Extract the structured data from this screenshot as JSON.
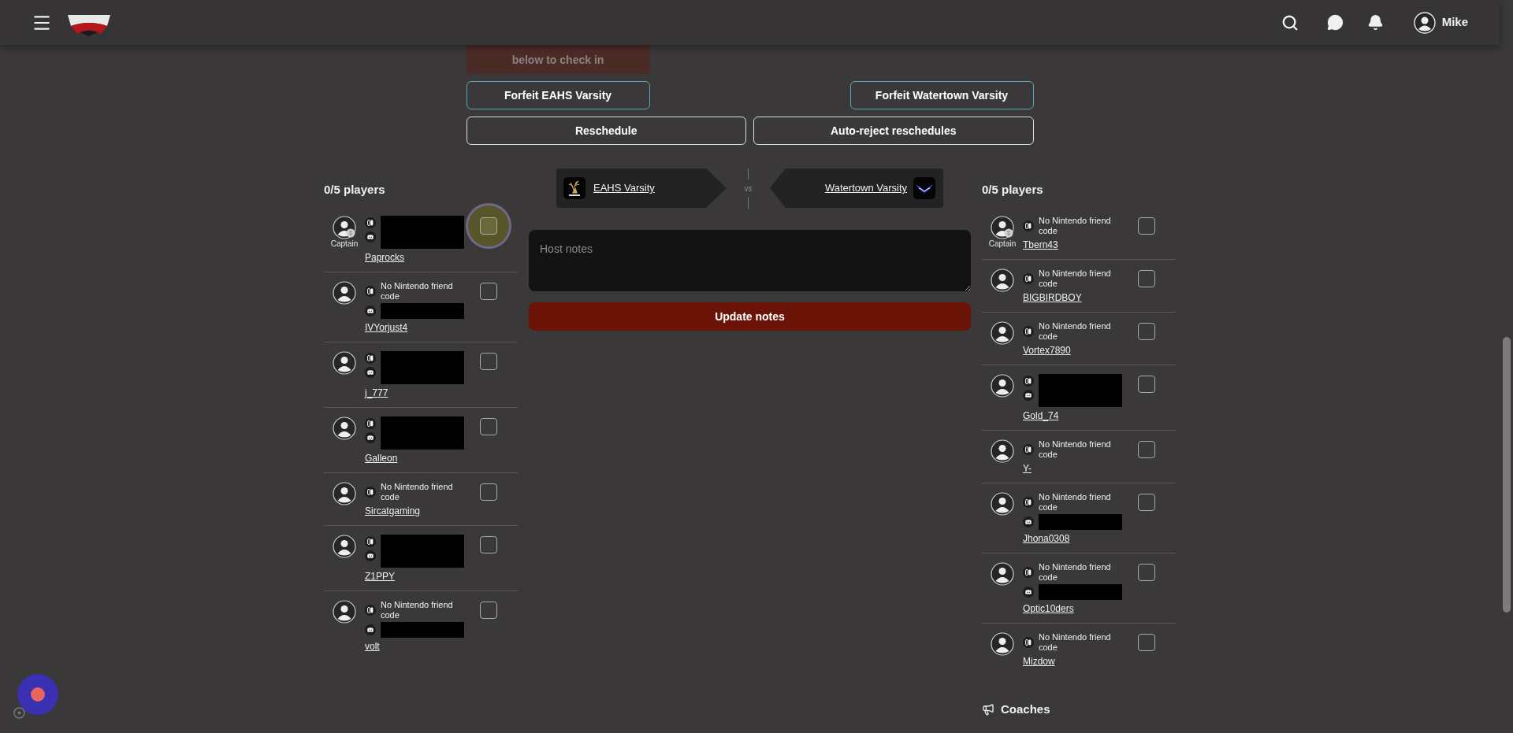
{
  "topbar": {
    "user": "Mike"
  },
  "checkin_notice": "below to check in",
  "actions": {
    "forfeit": [
      "Forfeit EAHS Varsity",
      "Forfeit Watertown Varsity"
    ],
    "reschedule": "Reschedule",
    "auto_reject": "Auto-reject reschedules"
  },
  "matchup": {
    "home": "EAHS Varsity",
    "away": "Watertown Varsity",
    "vs": "vs"
  },
  "notes": {
    "placeholder": "Host notes",
    "button": "Update notes"
  },
  "teams": [
    {
      "count": "0/5 players",
      "players": [
        {
          "name": "Paprocks",
          "role": "Captain",
          "switch_redacted": true,
          "discord": true,
          "checked": false,
          "focused": true
        },
        {
          "name": "IVYorjust4",
          "friend_code": "No Nintendo friend code",
          "discord": true,
          "checked": false,
          "focused": false
        },
        {
          "name": "j_777",
          "switch_redacted": true,
          "discord": true,
          "checked": false,
          "focused": false
        },
        {
          "name": "Galleon",
          "switch_redacted": true,
          "discord": true,
          "checked": false,
          "focused": false
        },
        {
          "name": "Sircatgaming",
          "friend_code": "No Nintendo friend code",
          "discord": false,
          "checked": false,
          "focused": false
        },
        {
          "name": "Z1PPY",
          "switch_redacted": true,
          "discord": true,
          "checked": false,
          "focused": false
        },
        {
          "name": "volt",
          "friend_code": "No Nintendo friend code",
          "discord": true,
          "checked": false,
          "focused": false
        }
      ]
    },
    {
      "count": "0/5 players",
      "players": [
        {
          "name": "Tbern43",
          "role": "Captain",
          "friend_code": "No Nintendo friend code",
          "discord": false,
          "checked": false,
          "focused": false
        },
        {
          "name": "BIGBIRDBOY",
          "friend_code": "No Nintendo friend code",
          "discord": false,
          "checked": false,
          "focused": false
        },
        {
          "name": "Vortex7890",
          "friend_code": "No Nintendo friend code",
          "discord": false,
          "checked": false,
          "focused": false
        },
        {
          "name": "Gold_74",
          "switch_redacted": true,
          "discord": true,
          "checked": false,
          "focused": false
        },
        {
          "name": "Y-",
          "friend_code": "No Nintendo friend code",
          "discord": false,
          "checked": false,
          "focused": false
        },
        {
          "name": "Jhona0308",
          "friend_code": "No Nintendo friend code",
          "discord": true,
          "checked": false,
          "focused": false
        },
        {
          "name": "Optic10ders",
          "friend_code": "No Nintendo friend code",
          "discord": true,
          "checked": false,
          "focused": false
        },
        {
          "name": "Mizdow",
          "friend_code": "No Nintendo friend code",
          "discord": false,
          "checked": false,
          "focused": false
        }
      ]
    }
  ],
  "coaches": {
    "title": "Coaches"
  }
}
